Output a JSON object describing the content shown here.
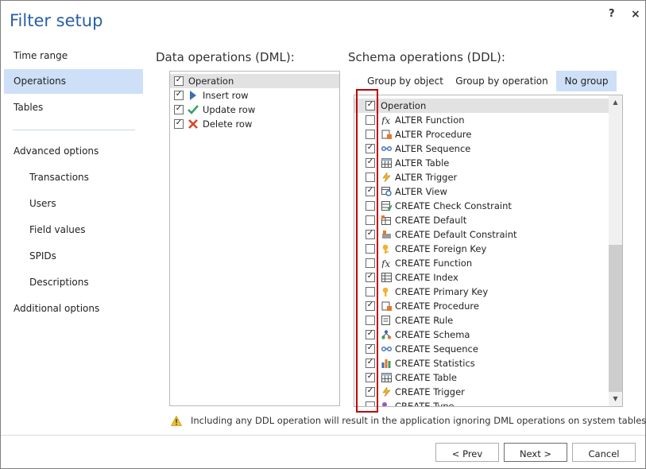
{
  "window": {
    "title": "Filter setup",
    "help_label": "?",
    "close_label": "×"
  },
  "nav": {
    "items": [
      {
        "label": "Time range"
      },
      {
        "label": "Operations"
      },
      {
        "label": "Tables"
      },
      {
        "label": "Advanced options"
      },
      {
        "label": "Transactions"
      },
      {
        "label": "Users"
      },
      {
        "label": "Field values"
      },
      {
        "label": "SPIDs"
      },
      {
        "label": "Descriptions"
      },
      {
        "label": "Additional options"
      }
    ]
  },
  "dml": {
    "title": "Data operations (DML):",
    "header": {
      "label": "Operation",
      "checked": true
    },
    "items": [
      {
        "label": "Insert row",
        "checked": true,
        "icon": "play-arrow-icon"
      },
      {
        "label": "Update row",
        "checked": true,
        "icon": "check-mark-icon"
      },
      {
        "label": "Delete row",
        "checked": true,
        "icon": "red-x-icon"
      }
    ]
  },
  "ddl": {
    "title": "Schema operations (DDL):",
    "tabs": [
      {
        "label": "Group by object"
      },
      {
        "label": "Group by operation"
      },
      {
        "label": "No group"
      }
    ],
    "header": {
      "label": "Operation",
      "checked": true
    },
    "items": [
      {
        "label": "ALTER Function",
        "checked": false,
        "icon": "function-icon"
      },
      {
        "label": "ALTER Procedure",
        "checked": false,
        "icon": "procedure-icon"
      },
      {
        "label": "ALTER Sequence",
        "checked": true,
        "icon": "sequence-icon"
      },
      {
        "label": "ALTER Table",
        "checked": true,
        "icon": "table-icon"
      },
      {
        "label": "ALTER Trigger",
        "checked": false,
        "icon": "trigger-icon"
      },
      {
        "label": "ALTER View",
        "checked": true,
        "icon": "view-icon"
      },
      {
        "label": "CREATE Check Constraint",
        "checked": false,
        "icon": "check-constraint-icon"
      },
      {
        "label": "CREATE Default",
        "checked": false,
        "icon": "default-icon"
      },
      {
        "label": "CREATE Default Constraint",
        "checked": true,
        "icon": "default-constraint-icon"
      },
      {
        "label": "CREATE Foreign Key",
        "checked": false,
        "icon": "foreign-key-icon"
      },
      {
        "label": "CREATE Function",
        "checked": false,
        "icon": "function-icon"
      },
      {
        "label": "CREATE Index",
        "checked": true,
        "icon": "index-icon"
      },
      {
        "label": "CREATE Primary Key",
        "checked": false,
        "icon": "primary-key-icon"
      },
      {
        "label": "CREATE Procedure",
        "checked": true,
        "icon": "procedure-icon"
      },
      {
        "label": "CREATE Rule",
        "checked": false,
        "icon": "rule-icon"
      },
      {
        "label": "CREATE Schema",
        "checked": true,
        "icon": "schema-icon"
      },
      {
        "label": "CREATE Sequence",
        "checked": true,
        "icon": "sequence-icon"
      },
      {
        "label": "CREATE Statistics",
        "checked": true,
        "icon": "statistics-icon"
      },
      {
        "label": "CREATE Table",
        "checked": true,
        "icon": "table-icon"
      },
      {
        "label": "CREATE Trigger",
        "checked": true,
        "icon": "trigger-icon"
      },
      {
        "label": "CREATE Type",
        "checked": false,
        "icon": "type-icon"
      }
    ]
  },
  "warning": "Including any DDL operation will result in the application ignoring DML operations on system tables",
  "footer": {
    "prev_label": "< Prev",
    "next_label": "Next >",
    "cancel_label": "Cancel"
  }
}
